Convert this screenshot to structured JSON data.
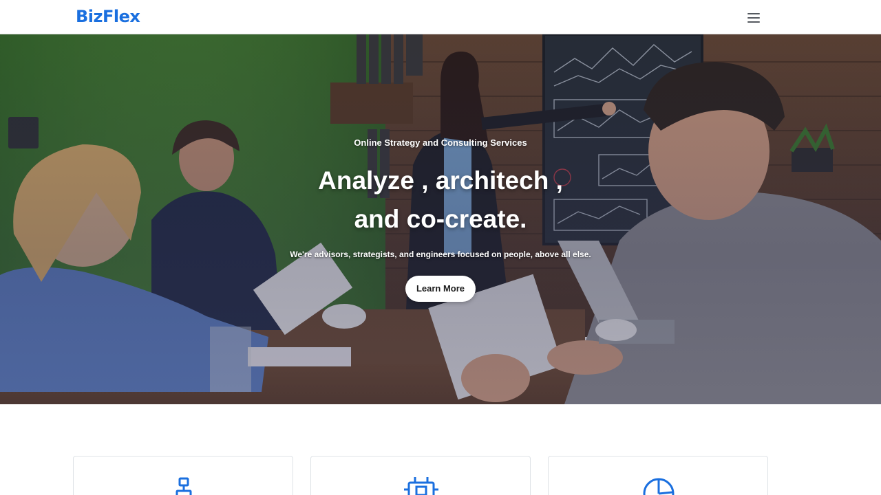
{
  "header": {
    "brand": "BizFlex",
    "menu_icon": "hamburger-menu-icon",
    "brand_color": "#1a6fdf"
  },
  "hero": {
    "eyebrow": "Online Strategy and Consulting Services",
    "headline_line1": "Analyze , architech ,",
    "headline_line2": "and co-create.",
    "subline": "We're advisors, strategists, and engineers focused on people, above all else.",
    "cta_label": "Learn More",
    "background": "office-meeting-photo"
  },
  "features": {
    "cards": [
      {
        "icon": "hierarchy-structure-icon"
      },
      {
        "icon": "cpu-chip-icon"
      },
      {
        "icon": "pie-chart-icon"
      }
    ],
    "accent_color": "#1a6fdf"
  }
}
